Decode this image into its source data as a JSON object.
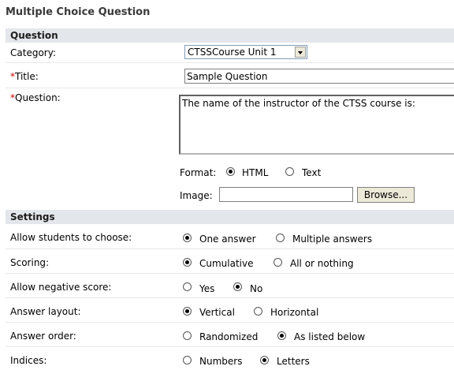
{
  "page": {
    "title": "Multiple Choice Question"
  },
  "question_section": {
    "header": "Question",
    "category_label": "Category:",
    "category_value": "CTSSCourse Unit 1",
    "title_required": "*",
    "title_label": "Title:",
    "title_value": "Sample Question",
    "question_required": "*",
    "question_label": "Question:",
    "question_value": "The name of the instructor of the CTSS course is:",
    "format_label": "Format:",
    "format_html": "HTML",
    "format_text": "Text",
    "image_label": "Image:",
    "browse_label": "Browse..."
  },
  "settings": {
    "header": "Settings",
    "choose_label": "Allow students to choose:",
    "choose_one": "One answer",
    "choose_multi": "Multiple answers",
    "scoring_label": "Scoring:",
    "scoring_cumulative": "Cumulative",
    "scoring_all": "All or nothing",
    "negative_label": "Allow negative score:",
    "negative_yes": "Yes",
    "negative_no": "No",
    "layout_label": "Answer layout:",
    "layout_vertical": "Vertical",
    "layout_horizontal": "Horizontal",
    "order_label": "Answer order:",
    "order_random": "Randomized",
    "order_listed": "As listed below",
    "indices_label": "Indices:",
    "indices_numbers": "Numbers",
    "indices_letters": "Letters"
  }
}
